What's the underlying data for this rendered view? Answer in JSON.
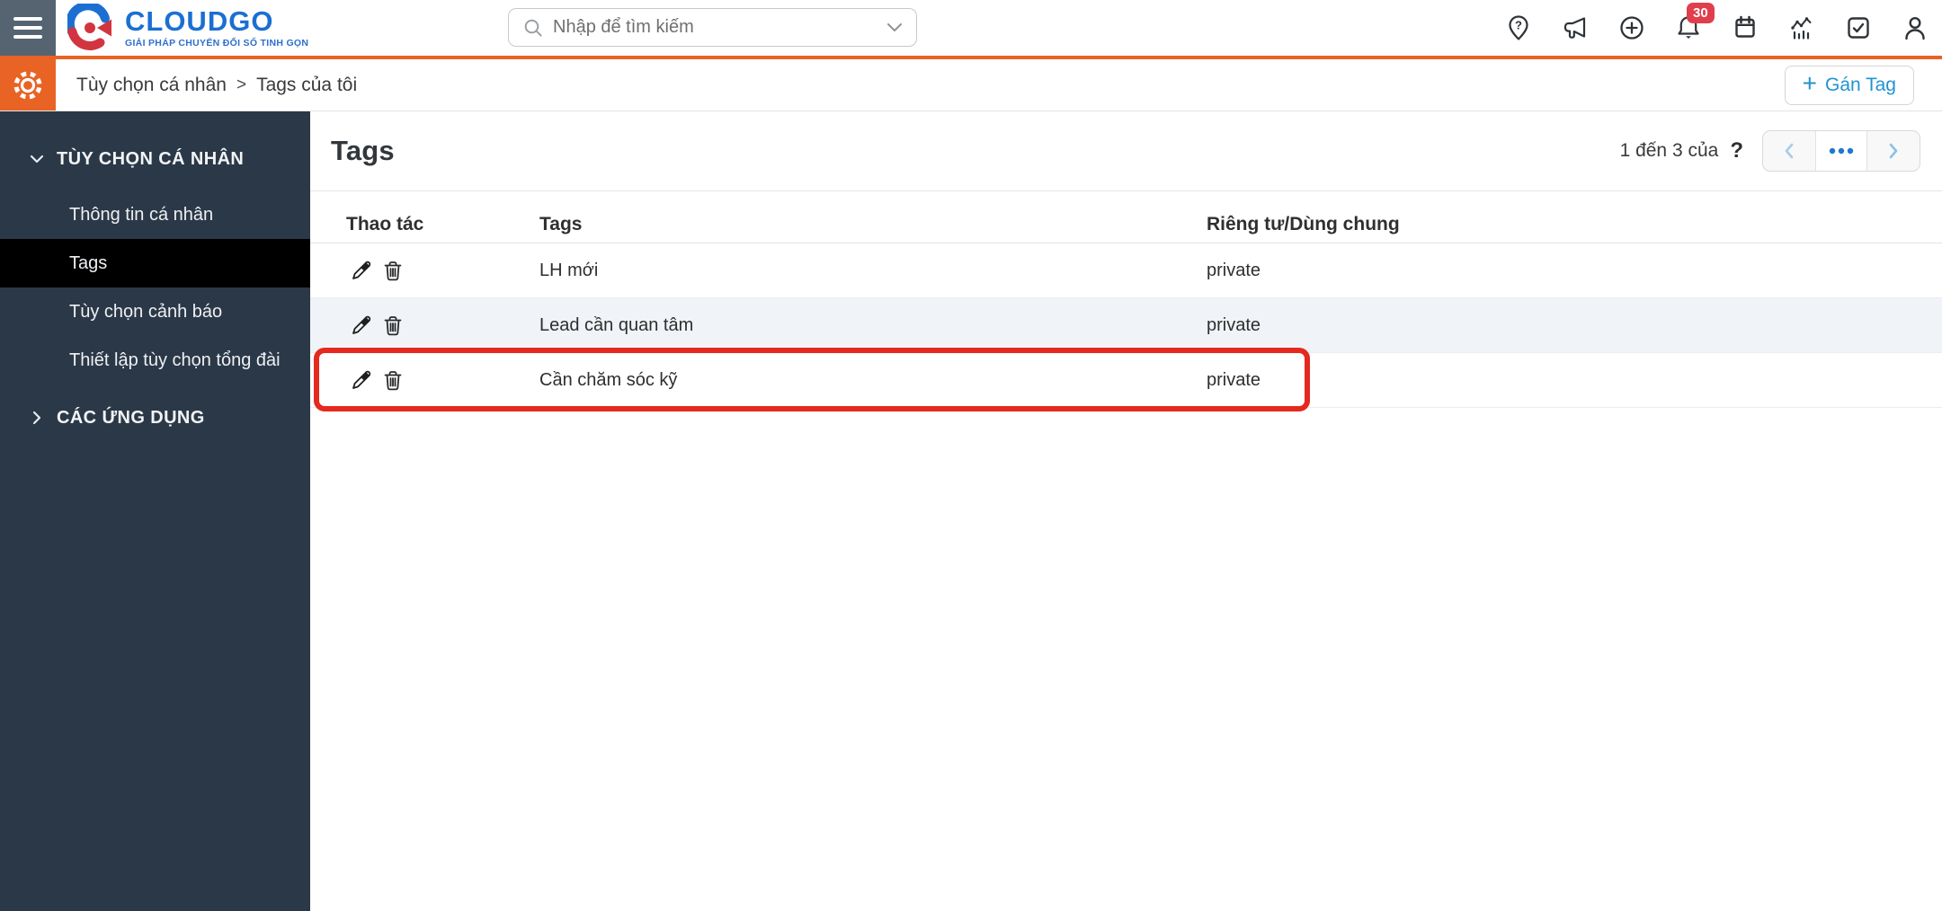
{
  "colors": {
    "accent": "#2193d2",
    "orange": "#e96325",
    "sidebar_bg": "#2b3847",
    "sidebar_active": "#000000",
    "menu_bg": "#566472",
    "badge": "#e03e4c",
    "highlight": "#e5291e",
    "row_alt": "#f0f4f8",
    "logo_blue": "#1b6fd2",
    "logo_red": "#d2353f"
  },
  "topbar": {
    "logo": {
      "name": "CLOUDGO",
      "tagline": "GIẢI PHÁP CHUYỂN ĐỔI SỐ TINH GỌN"
    },
    "search": {
      "placeholder": "Nhập để tìm kiếm"
    },
    "notification_count": "30",
    "icons": [
      "hamburger-icon",
      "location-question-icon",
      "megaphone-icon",
      "plus-circle-icon",
      "bell-icon",
      "calendar-icon",
      "analytics-icon",
      "task-check-icon",
      "user-icon"
    ]
  },
  "breadcrumb": {
    "parent": "Tùy chọn cá nhân",
    "separator": ">",
    "current": "Tags của tôi"
  },
  "actions": {
    "assign_tag_plus": "+",
    "assign_tag_label": "Gán Tag"
  },
  "sidebar": {
    "section1": {
      "label": "TÙY CHỌN CÁ NHÂN",
      "expanded": true,
      "items": [
        "Thông tin cá nhân",
        "Tags",
        "Tùy chọn cảnh báo",
        "Thiết lập tùy chọn tổng đài"
      ],
      "active_item": "Tags"
    },
    "section2": {
      "label": "CÁC ỨNG DỤNG",
      "expanded": false
    }
  },
  "main": {
    "title": "Tags",
    "pagination": {
      "range_label": "1 đến 3 của",
      "unknown_total": "?",
      "icons": [
        "chevron-left-icon",
        "pagination-pages-icon",
        "chevron-right-icon"
      ]
    },
    "table": {
      "columns": [
        "Thao tác",
        "Tags",
        "Riêng tư/Dùng chung"
      ],
      "row_action_icons": [
        "pencil-icon",
        "trash-icon"
      ],
      "rows": [
        {
          "tag": "LH mới",
          "privacy": "private",
          "highlighted": false
        },
        {
          "tag": "Lead cần quan tâm",
          "privacy": "private",
          "highlighted": false
        },
        {
          "tag": "Cần chăm sóc kỹ",
          "privacy": "private",
          "highlighted": true
        }
      ]
    }
  }
}
